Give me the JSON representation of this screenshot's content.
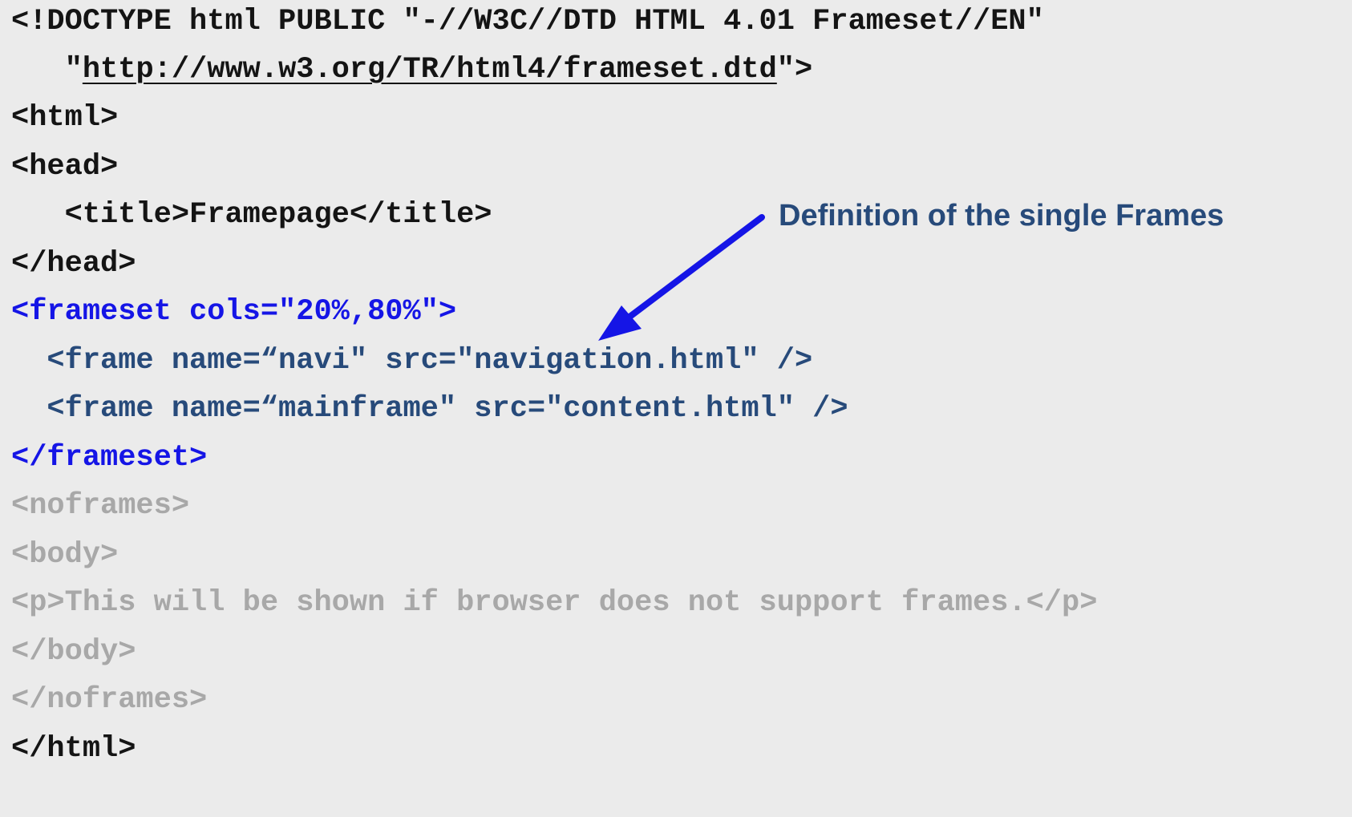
{
  "code": {
    "doctype_line1": "<!DOCTYPE html PUBLIC \"-//W3C//DTD HTML 4.01 Frameset//EN\"",
    "doctype_line2_prefix": "   \"",
    "doctype_line2_url": "http://www.w3.org/TR/html4/frameset.dtd",
    "doctype_line2_suffix": "\">",
    "html_open": "<html>",
    "head_open": "<head>",
    "title_line": "   <title>Framepage</title>",
    "head_close": "</head>",
    "frameset_open": "<frameset cols=\"20%,80%\">",
    "frame_navi": "  <frame name=“navi\" src=\"navigation.html\" />",
    "frame_main": "  <frame name=“mainframe\" src=\"content.html\" />",
    "frameset_close": "</frameset>",
    "noframes_open": "<noframes>",
    "body_open": "<body>",
    "p_line": "<p>This will be shown if browser does not support frames.</p>",
    "body_close": "</body>",
    "noframes_close": "</noframes>",
    "html_close": "</html>"
  },
  "annotation": {
    "text": "Definition of the single Frames"
  },
  "colors": {
    "background": "#ebebeb",
    "code_default": "#141414",
    "frame_lines": "#274a7a",
    "frameset_lines": "#1515e6",
    "noframes_lines": "#a8a8a8",
    "annotation_text": "#274a7a",
    "arrow": "#1515e6"
  }
}
